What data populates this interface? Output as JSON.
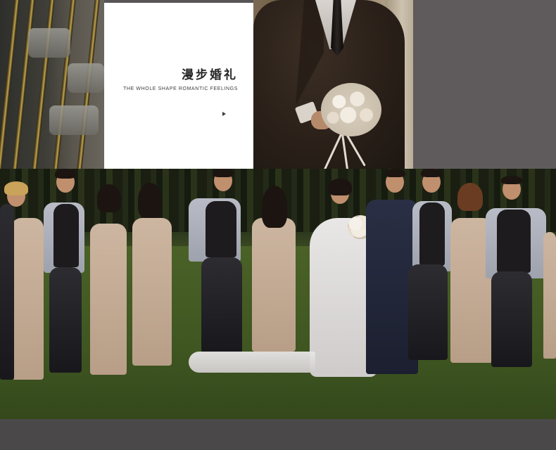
{
  "card": {
    "title": "漫步婚礼",
    "subtitle": "THE WHOLE SHAPE ROMANTIC FEELINGS",
    "arrow_icon": "play-arrow-icon"
  },
  "colors": {
    "card_background": "#ffffff",
    "page_background": "#575456",
    "title_text": "#262626"
  }
}
